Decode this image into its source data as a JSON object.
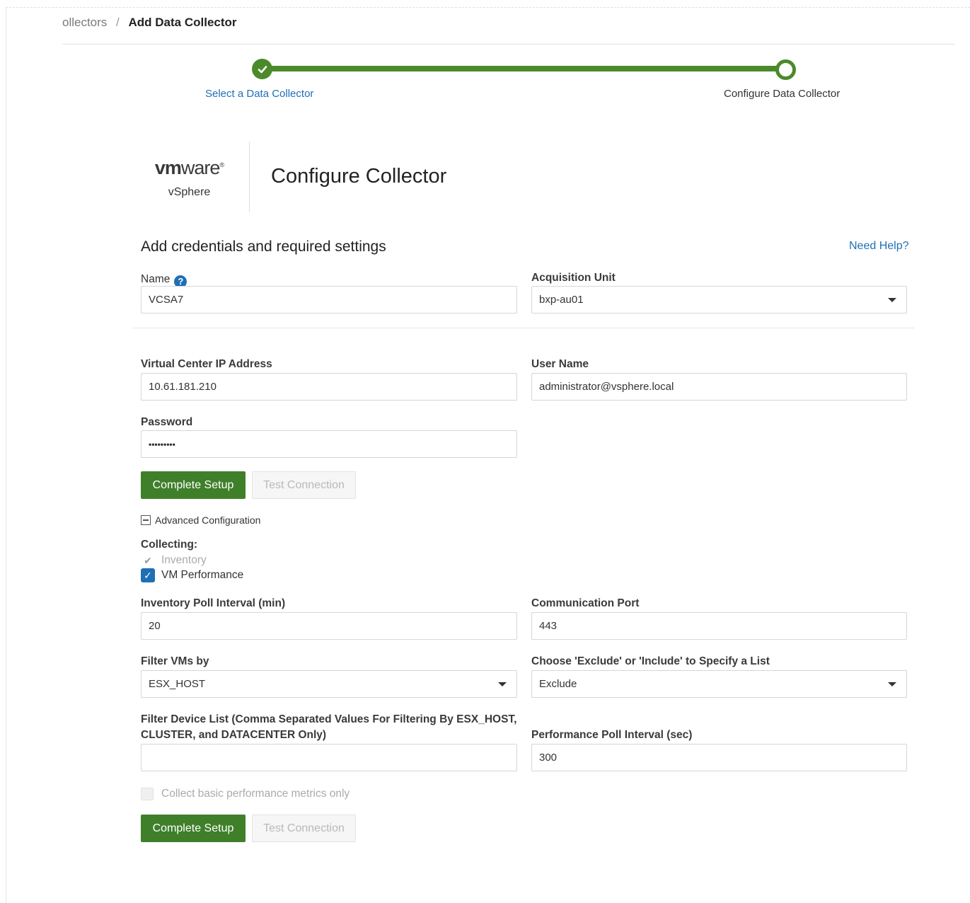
{
  "breadcrumb": {
    "parent": "ollectors",
    "separator": "/",
    "current": "Add Data Collector"
  },
  "stepper": {
    "steps": [
      {
        "label": "Select a Data Collector",
        "state": "completed"
      },
      {
        "label": "Configure Data Collector",
        "state": "current"
      }
    ],
    "accent_color": "#4b8a2a"
  },
  "collector": {
    "logo_bold": "vm",
    "logo_rest": "ware",
    "logo_mark": "®",
    "product": "vSphere"
  },
  "page_title": "Configure Collector",
  "section": {
    "title": "Add credentials and required settings",
    "help_link": "Need Help?"
  },
  "form": {
    "name": {
      "label": "Name",
      "value": "VCSA7",
      "help_icon": "question-circle-icon"
    },
    "acquisition_unit": {
      "label": "Acquisition Unit",
      "value": "bxp-au01"
    },
    "vc_ip": {
      "label": "Virtual Center IP Address",
      "value": "10.61.181.210"
    },
    "user_name": {
      "label": "User Name",
      "value": "administrator@vsphere.local"
    },
    "password": {
      "label": "Password",
      "value": "•••••••••"
    }
  },
  "buttons": {
    "complete": "Complete Setup",
    "test": "Test Connection"
  },
  "advanced": {
    "toggle_label": "Advanced Configuration",
    "collecting_label": "Collecting:",
    "inventory_label": "Inventory",
    "vm_performance_label": "VM Performance",
    "inventory_poll": {
      "label": "Inventory Poll Interval (min)",
      "value": "20"
    },
    "comm_port": {
      "label": "Communication Port",
      "value": "443"
    },
    "filter_vms": {
      "label": "Filter VMs by",
      "value": "ESX_HOST"
    },
    "exclude_include": {
      "label": "Choose 'Exclude' or 'Include' to Specify a List",
      "value": "Exclude"
    },
    "filter_device_list": {
      "label_line1": "Filter Device List (Comma Separated Values For Filtering By ESX_HOST,",
      "label_line2": "CLUSTER, and DATACENTER Only)",
      "value": ""
    },
    "perf_poll": {
      "label": "Performance Poll Interval (sec)",
      "value": "300"
    },
    "basic_metrics_label": "Collect basic performance metrics only"
  },
  "colors": {
    "link_blue": "#1f6fb5",
    "button_green": "#3f7f2a"
  }
}
